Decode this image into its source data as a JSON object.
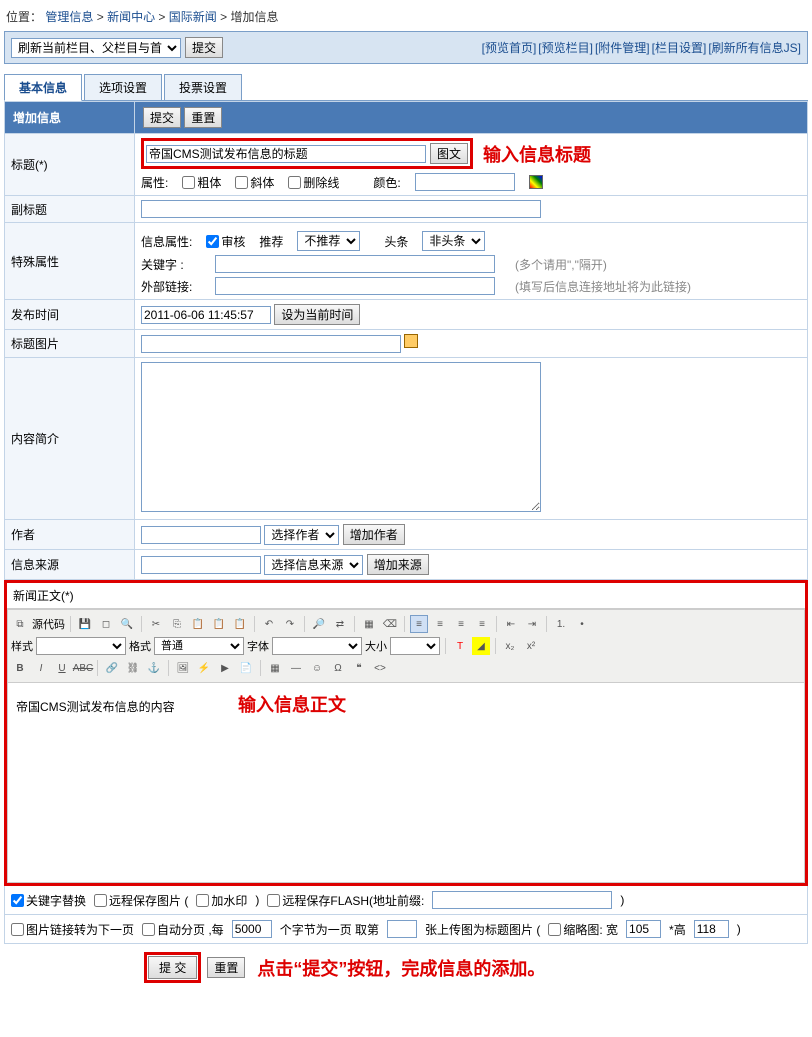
{
  "breadcrumb": {
    "prefix": "位置：",
    "items": [
      "管理信息",
      "新闻中心",
      "国际新闻",
      "增加信息"
    ],
    "sep": " > "
  },
  "topbar": {
    "refresh_select": "刷新当前栏目、父栏目与首页",
    "submit": "提交",
    "links": [
      "[预览首页]",
      "[预览栏目]",
      "[附件管理]",
      "[栏目设置]",
      "[刷新所有信息JS]"
    ]
  },
  "tabs": [
    "基本信息",
    "选项设置",
    "投票设置"
  ],
  "header": {
    "title": "增加信息",
    "submit": "提交",
    "reset": "重置"
  },
  "fields": {
    "title": {
      "label": "标题(*)",
      "value": "帝国CMS测试发布信息的标题",
      "pic_btn": "图文",
      "annotation": "输入信息标题",
      "attr_label": "属性:",
      "bold": "粗体",
      "italic": "斜体",
      "strike": "删除线",
      "color_label": "颜色:"
    },
    "subtitle": {
      "label": "副标题"
    },
    "special": {
      "label": "特殊属性",
      "info_attr_label": "信息属性:",
      "audit": "审核",
      "recommend_label": "推荐",
      "recommend_sel": "不推荐",
      "headline_label": "头条",
      "headline_sel": "非头条",
      "keyword_label": "关键字   :",
      "keyword_hint": "(多个请用\",\"隔开)",
      "extlink_label": "外部链接:",
      "extlink_hint": "(填写后信息连接地址将为此链接)"
    },
    "pubtime": {
      "label": "发布时间",
      "value": "2011-06-06 11:45:57",
      "set_now": "设为当前时间"
    },
    "titlepic": {
      "label": "标题图片"
    },
    "intro": {
      "label": "内容简介"
    },
    "author": {
      "label": "作者",
      "select": "选择作者",
      "add": "增加作者"
    },
    "source": {
      "label": "信息来源",
      "select": "选择信息来源",
      "add": "增加来源"
    }
  },
  "editor": {
    "title": "新闻正文(*)",
    "source_btn": "源代码",
    "style_label": "样式",
    "format_label": "格式",
    "format_value": "普通",
    "font_label": "字体",
    "size_label": "大小",
    "content": "帝国CMS测试发布信息的内容",
    "annotation": "输入信息正文"
  },
  "options": {
    "keyword_replace": "关键字替换",
    "remote_img": "远程保存图片 (",
    "watermark": "加水印",
    "close_paren": ")",
    "remote_flash": "远程保存FLASH(地址前缀:",
    "img_link_next": "图片链接转为下一页",
    "auto_page": "自动分页 ,每",
    "auto_page_val": "5000",
    "auto_page_suffix": "个字节为一页   取第",
    "upload_suffix": "张上传图为标题图片 (",
    "thumb": "缩略图: 宽",
    "thumb_w": "105",
    "thumb_h_label": "*高",
    "thumb_h": "118"
  },
  "bottom": {
    "submit": "提 交",
    "reset": "重置",
    "annotation": "点击“提交”按钮，完成信息的添加。"
  }
}
